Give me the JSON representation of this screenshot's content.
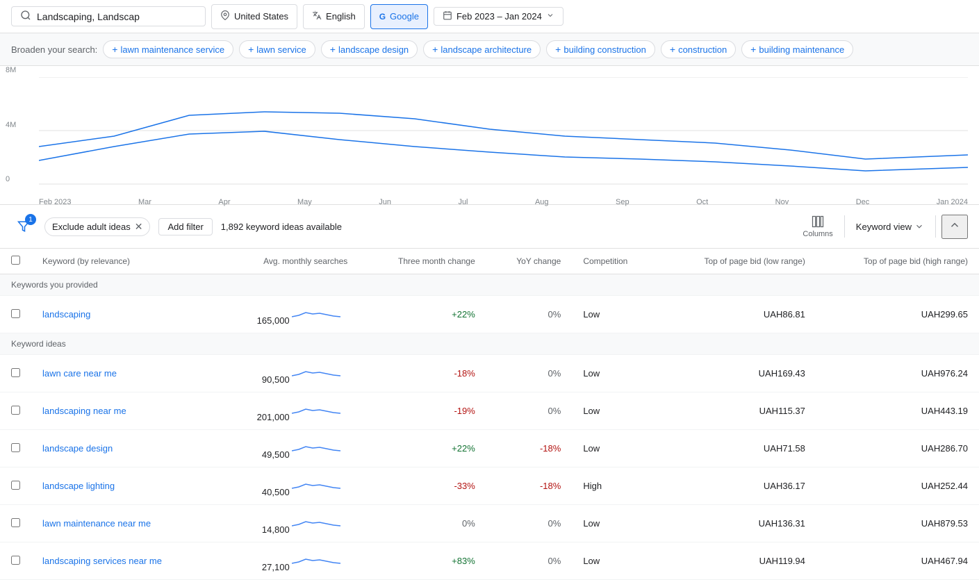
{
  "topbar": {
    "search_placeholder": "Landscaping, Landscap",
    "search_value": "Landscaping, Landscap",
    "location": "United States",
    "language": "English",
    "network": "Google",
    "date_range": "Feb 2023 – Jan 2024"
  },
  "broaden": {
    "label": "Broaden your search:",
    "tags": [
      "lawn maintenance service",
      "lawn service",
      "landscape design",
      "landscape architecture",
      "building construction",
      "construction",
      "building maintenance"
    ]
  },
  "chart": {
    "y_labels": [
      "8M",
      "4M",
      "0"
    ],
    "x_labels": [
      "Feb 2023",
      "Mar",
      "Apr",
      "May",
      "Jun",
      "Jul",
      "Aug",
      "Sep",
      "Oct",
      "Nov",
      "Dec",
      "Jan 2024"
    ]
  },
  "filter_bar": {
    "badge_count": "1",
    "exclude_tag": "Exclude adult ideas",
    "add_filter": "Add filter",
    "ideas_count": "1,892 keyword ideas available",
    "columns_label": "Columns",
    "keyword_view_label": "Keyword view"
  },
  "table": {
    "headers": [
      "Keyword (by relevance)",
      "Avg. monthly searches",
      "Three month change",
      "YoY change",
      "Competition",
      "Top of page bid (low range)",
      "Top of page bid (high range)"
    ],
    "provided_section": "Keywords you provided",
    "provided_rows": [
      {
        "keyword": "landscaping",
        "avg_searches": "165,000",
        "three_month_change": "+22%",
        "yoy_change": "0%",
        "competition": "Low",
        "bid_low": "UAH86.81",
        "bid_high": "UAH299.65",
        "change_type": "pos",
        "yoy_type": "zero"
      }
    ],
    "ideas_section": "Keyword ideas",
    "ideas_rows": [
      {
        "keyword": "lawn care near me",
        "avg_searches": "90,500",
        "three_month_change": "-18%",
        "yoy_change": "0%",
        "competition": "Low",
        "bid_low": "UAH169.43",
        "bid_high": "UAH976.24",
        "change_type": "neg",
        "yoy_type": "zero"
      },
      {
        "keyword": "landscaping near me",
        "avg_searches": "201,000",
        "three_month_change": "-19%",
        "yoy_change": "0%",
        "competition": "Low",
        "bid_low": "UAH115.37",
        "bid_high": "UAH443.19",
        "change_type": "neg",
        "yoy_type": "zero"
      },
      {
        "keyword": "landscape design",
        "avg_searches": "49,500",
        "three_month_change": "+22%",
        "yoy_change": "-18%",
        "competition": "Low",
        "bid_low": "UAH71.58",
        "bid_high": "UAH286.70",
        "change_type": "pos",
        "yoy_type": "neg"
      },
      {
        "keyword": "landscape lighting",
        "avg_searches": "40,500",
        "three_month_change": "-33%",
        "yoy_change": "-18%",
        "competition": "High",
        "bid_low": "UAH36.17",
        "bid_high": "UAH252.44",
        "change_type": "neg",
        "yoy_type": "neg"
      },
      {
        "keyword": "lawn maintenance near me",
        "avg_searches": "14,800",
        "three_month_change": "0%",
        "yoy_change": "0%",
        "competition": "Low",
        "bid_low": "UAH136.31",
        "bid_high": "UAH879.53",
        "change_type": "zero",
        "yoy_type": "zero"
      },
      {
        "keyword": "landscaping services near me",
        "avg_searches": "27,100",
        "three_month_change": "+83%",
        "yoy_change": "0%",
        "competition": "Low",
        "bid_low": "UAH119.94",
        "bid_high": "UAH467.94",
        "change_type": "pos",
        "yoy_type": "zero"
      }
    ]
  }
}
